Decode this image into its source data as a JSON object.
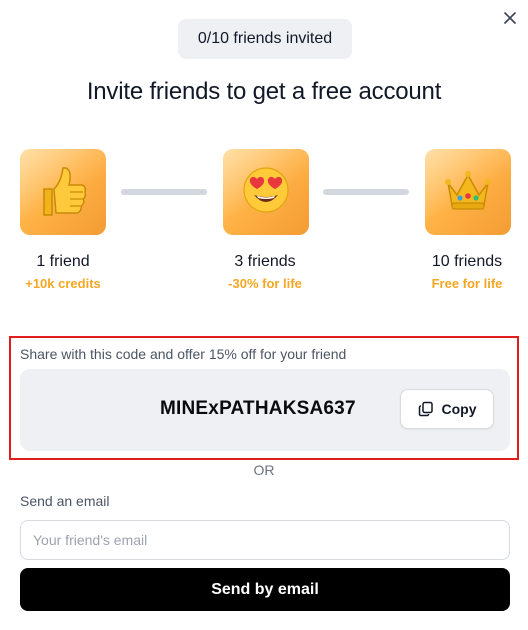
{
  "counter": {
    "label": "0/10 friends invited"
  },
  "title": "Invite friends to get a free account",
  "tiers": [
    {
      "name": "1 friend",
      "reward": "+10k credits",
      "icon": "thumbs-up-icon"
    },
    {
      "name": "3 friends",
      "reward": "-30% for life",
      "icon": "heart-eyes-emoji-icon"
    },
    {
      "name": "10 friends",
      "reward": "Free for life",
      "icon": "crown-icon"
    }
  ],
  "share": {
    "label": "Share with this code and offer 15% off for your friend",
    "code": "MINExPATHAKSA637",
    "copy_label": "Copy"
  },
  "divider": "OR",
  "email": {
    "label": "Send an email",
    "placeholder": "Your friend's email",
    "value": "",
    "send_label": "Send by email"
  },
  "colors": {
    "accent": "#f5a623",
    "primary_button": "#000000",
    "highlight_border": "#e11d1d"
  }
}
